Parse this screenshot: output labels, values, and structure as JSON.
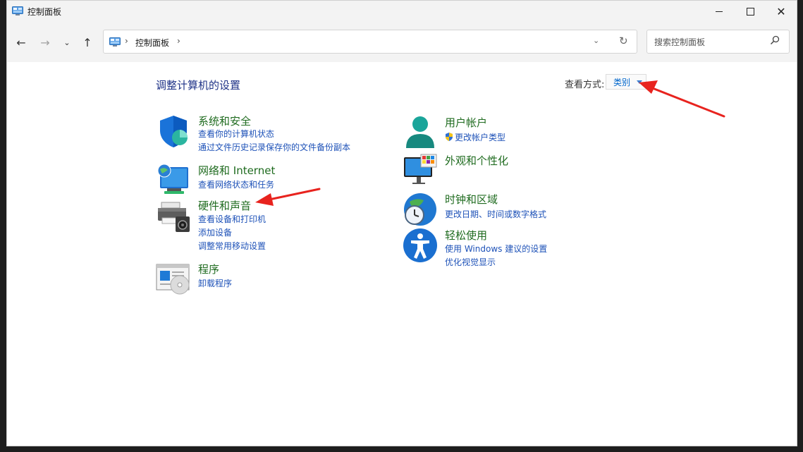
{
  "window": {
    "title": "控制面板",
    "controls": {
      "minimize": "minimize",
      "maximize": "maximize",
      "close": "close"
    }
  },
  "nav": {
    "address_path": "控制面板",
    "address_sep": "›",
    "search_placeholder": "搜索控制面板"
  },
  "content": {
    "heading": "调整计算机的设置",
    "view_by_label": "查看方式:",
    "view_by_value": "类别"
  },
  "categories": {
    "system_security": {
      "title": "系统和安全",
      "links": [
        "查看你的计算机状态",
        "通过文件历史记录保存你的文件备份副本"
      ]
    },
    "network": {
      "title": "网络和 Internet",
      "links": [
        "查看网络状态和任务"
      ]
    },
    "hardware": {
      "title": "硬件和声音",
      "links": [
        "查看设备和打印机",
        "添加设备",
        "调整常用移动设置"
      ]
    },
    "programs": {
      "title": "程序",
      "links": [
        "卸载程序"
      ]
    },
    "user_accounts": {
      "title": "用户帐户",
      "links": [
        "更改帐户类型"
      ]
    },
    "appearance": {
      "title": "外观和个性化",
      "links": []
    },
    "clock_region": {
      "title": "时钟和区域",
      "links": [
        "更改日期、时间或数字格式"
      ]
    },
    "ease_of_access": {
      "title": "轻松使用",
      "links": [
        "使用 Windows 建议的设置",
        "优化视觉显示"
      ]
    }
  },
  "colors": {
    "accent": "#0067c0",
    "category_title": "#1f6b1f",
    "link": "#1e52b8",
    "heading": "#1e3287",
    "annotation_arrow": "#e8231e"
  },
  "icons": {
    "app": "control-panel-icon",
    "back": "back-arrow-icon",
    "forward": "forward-arrow-icon",
    "recent": "chevron-down-icon",
    "up": "up-arrow-icon",
    "refresh": "refresh-icon",
    "search": "search-icon"
  }
}
